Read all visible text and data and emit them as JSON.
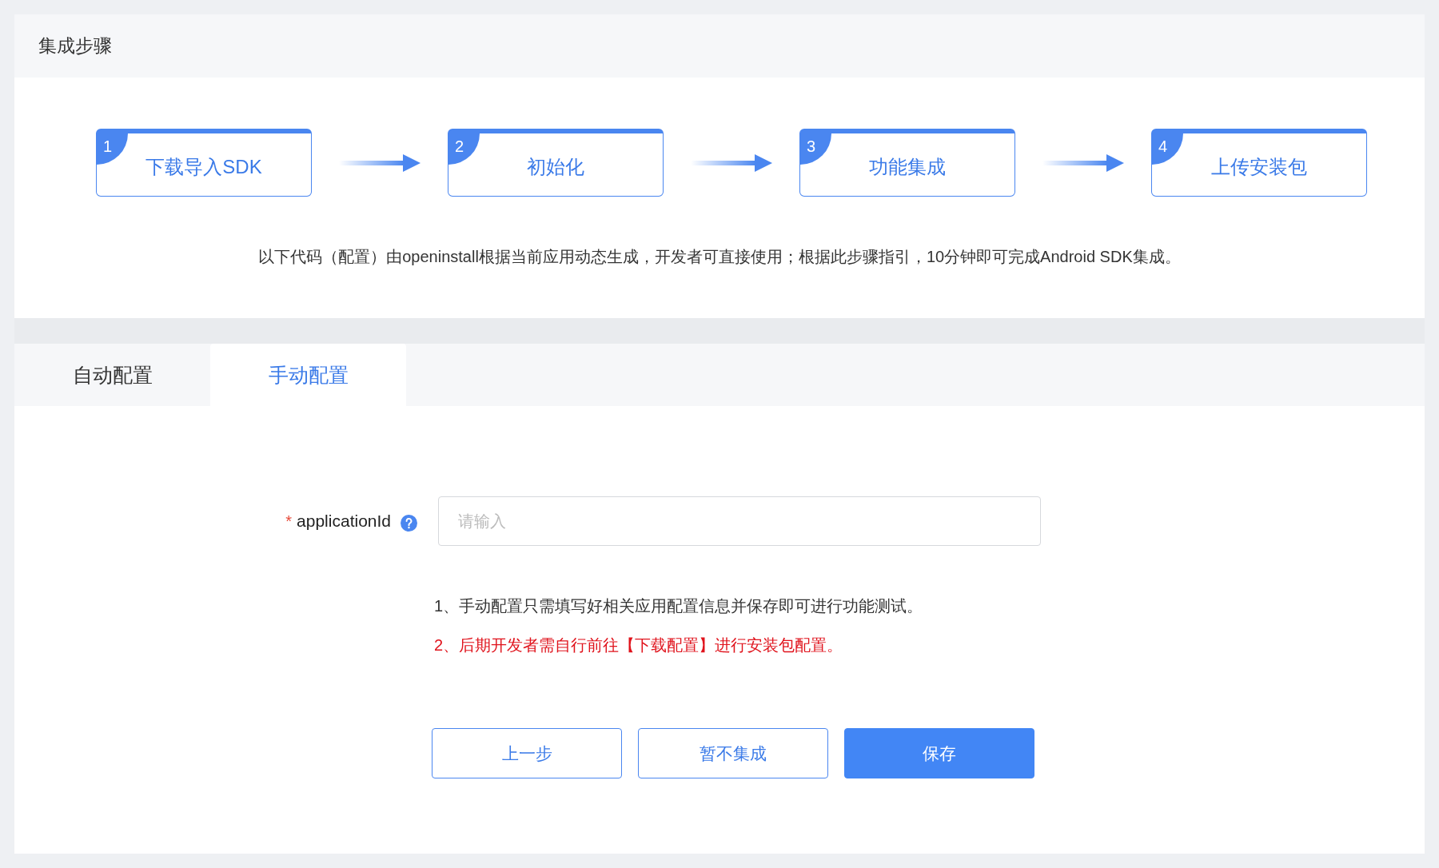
{
  "section_title": "集成步骤",
  "steps": [
    {
      "number": "1",
      "label": "下载导入SDK"
    },
    {
      "number": "2",
      "label": "初始化"
    },
    {
      "number": "3",
      "label": "功能集成"
    },
    {
      "number": "4",
      "label": "上传安装包"
    }
  ],
  "description": "以下代码（配置）由openinstall根据当前应用动态生成，开发者可直接使用；根据此步骤指引，10分钟即可完成Android SDK集成。",
  "tabs": [
    {
      "label": "自动配置",
      "selected": false
    },
    {
      "label": "手动配置",
      "selected": true
    }
  ],
  "form": {
    "field": {
      "required_mark": "*",
      "label": "applicationId",
      "placeholder": "请输入"
    },
    "notes": [
      {
        "kind": "info",
        "text": "1、手动配置只需填写好相关应用配置信息并保存即可进行功能测试。"
      },
      {
        "kind": "warning",
        "text": "2、后期开发者需自行前往【下载配置】进行安装包配置。"
      }
    ],
    "buttons": [
      {
        "kind": "outline",
        "label": "上一步"
      },
      {
        "kind": "outline",
        "label": "暂不集成"
      },
      {
        "kind": "primary",
        "label": "保存"
      }
    ]
  }
}
